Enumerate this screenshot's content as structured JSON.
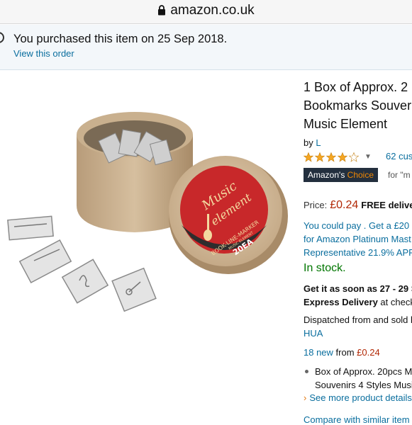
{
  "browser": {
    "url": "amazon.co.uk"
  },
  "purchase_notice": {
    "text": "You purchased this item on 25 Sep 2018.",
    "link": "View this order"
  },
  "product": {
    "title_lines": [
      "1 Box of Approx. 2",
      "Bookmarks Souver",
      "Music Element"
    ],
    "by_label": "by",
    "brand": "L",
    "rating": 4.5,
    "ratings_count": "62 cus",
    "choice_badge_prefix": "Amazon's",
    "choice_badge_suffix": "Choice",
    "choice_for": "for \"m",
    "price_label": "Price:",
    "price": "£0.24",
    "free_delivery": "FREE delive",
    "finance_lines": [
      "You could pay . Get a £20 g",
      "for Amazon Platinum Mast",
      "Representative 21.9% APR"
    ],
    "stock": "In stock.",
    "delivery_line1": "Get it as soon as 27 - 29 S",
    "delivery_line2_bold": "Express Delivery",
    "delivery_line2_rest": " at checko",
    "dispatch_line1": "Dispatched from and sold b",
    "seller": "HUA",
    "new_count": "18 new",
    "new_from_label": " from ",
    "new_from_price": "£0.24",
    "bullet_lines": [
      "Box of Approx. 20pcs M",
      "Souvenirs 4 Styles Musi"
    ],
    "see_more": "See more product details",
    "compare": "Compare with similar item",
    "image_label_lines": [
      "Music",
      "element",
      "BOOK-LINE-MARKER",
      "MUSIC ELEMENT",
      "20EA"
    ]
  },
  "colors": {
    "link": "#0a6e9e",
    "price": "#b12704",
    "stock": "#007600",
    "choice_bg": "#232f3e",
    "choice_accent": "#f08804",
    "star": "#f5a623"
  }
}
